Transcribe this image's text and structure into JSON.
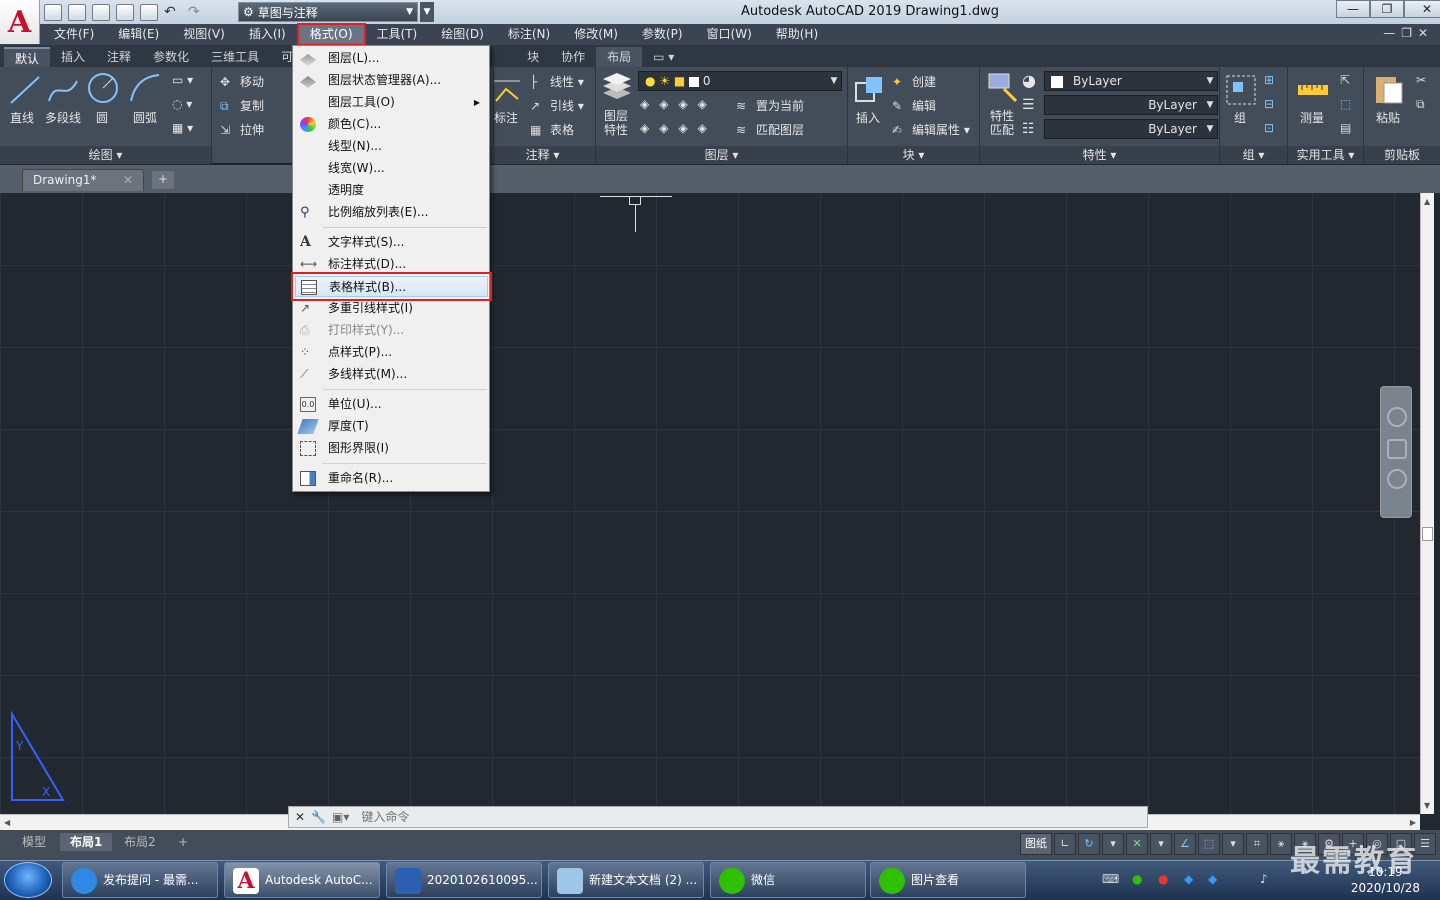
{
  "app": {
    "title": "Autodesk AutoCAD 2019    Drawing1.dwg",
    "logo_letter": "A",
    "workspace": "草图与注释",
    "window_controls": [
      "—",
      "❐",
      "✕"
    ],
    "mdi_controls": "—❐✕"
  },
  "menubar": [
    "文件(F)",
    "编辑(E)",
    "视图(V)",
    "插入(I)",
    "格式(O)",
    "工具(T)",
    "绘图(D)",
    "标注(N)",
    "修改(M)",
    "参数(P)",
    "窗口(W)",
    "帮助(H)"
  ],
  "ribbon_tabs": [
    "默认",
    "插入",
    "注释",
    "参数化",
    "三维工具",
    "可视",
    "块",
    "协作",
    "布局"
  ],
  "ribbon": {
    "draw": {
      "title": "绘图 ▾",
      "tools": [
        "直线",
        "多段线",
        "圆",
        "圆弧"
      ]
    },
    "modify": {
      "tools": [
        "移动",
        "复制",
        "拉伸"
      ]
    },
    "annotation": {
      "title": "注释 ▾",
      "big": "标注",
      "tools": [
        "线性",
        "引线",
        "表格"
      ]
    },
    "layers": {
      "title": "图层 ▾",
      "big": "图层\n特性",
      "layer_value": "0",
      "tools": [
        "置为当前",
        "匹配图层"
      ]
    },
    "block": {
      "title": "块 ▾",
      "big": "插入",
      "tools": [
        "创建",
        "编辑",
        "编辑属性"
      ]
    },
    "properties": {
      "title": "特性 ▾",
      "big": "特性\n匹配",
      "color": "ByLayer",
      "linetype": "ByLayer",
      "lineweight": "ByLayer"
    },
    "group": {
      "title": "组 ▾",
      "big": "组"
    },
    "utilities": {
      "title": "实用工具 ▾",
      "big": "测量"
    },
    "clipboard": {
      "title": "剪贴板",
      "big": "粘贴"
    }
  },
  "file_tab": {
    "name": "Drawing1*",
    "close": "✕",
    "add": "+"
  },
  "format_menu": {
    "items": [
      {
        "label": "图层(L)...",
        "icon": "layer-icon"
      },
      {
        "label": "图层状态管理器(A)...",
        "icon": "layer-state-icon"
      },
      {
        "label": "图层工具(O)",
        "icon": "none",
        "submenu": "▶"
      },
      {
        "label": "颜色(C)...",
        "icon": "color-wheel-icon"
      },
      {
        "label": "线型(N)...",
        "icon": "none"
      },
      {
        "label": "线宽(W)...",
        "icon": "none"
      },
      {
        "label": "透明度",
        "icon": "none"
      },
      {
        "label": "比例缩放列表(E)...",
        "icon": "scale-list-icon"
      },
      {
        "label": "文字样式(S)...",
        "icon": "text-style-icon"
      },
      {
        "label": "标注样式(D)...",
        "icon": "dim-style-icon"
      },
      {
        "label": "表格样式(B)...",
        "icon": "table-style-icon"
      },
      {
        "label": "多重引线样式(I)",
        "icon": "mleader-style-icon"
      },
      {
        "label": "打印样式(Y)...",
        "icon": "plot-style-icon"
      },
      {
        "label": "点样式(P)...",
        "icon": "point-style-icon"
      },
      {
        "label": "多线样式(M)...",
        "icon": "mline-style-icon"
      },
      {
        "label": "单位(U)...",
        "icon": "units-icon"
      },
      {
        "label": "厚度(T)",
        "icon": "thickness-icon"
      },
      {
        "label": "图形界限(I)",
        "icon": "limits-icon"
      },
      {
        "label": "重命名(R)...",
        "icon": "rename-icon"
      }
    ],
    "highlighted": "表格样式(B)...",
    "disabled": "打印样式(Y)..."
  },
  "command_line": {
    "placeholder": "键入命令"
  },
  "layout_tabs": [
    "模型",
    "布局1",
    "布局2",
    "+"
  ],
  "status": {
    "paper": "图纸"
  },
  "taskbar": {
    "items": [
      "发布提问 - 最需...",
      "Autodesk AutoC...",
      "2020102610095...",
      "新建文本文档 (2) ...",
      "微信",
      "图片查看"
    ],
    "clock_time": "10:19",
    "clock_date": "2020/10/28"
  },
  "watermark": "最需教育",
  "colors": {
    "highlight_box": "#e02020",
    "canvas_bg": "#212830",
    "ribbon_bg": "#434c59"
  }
}
